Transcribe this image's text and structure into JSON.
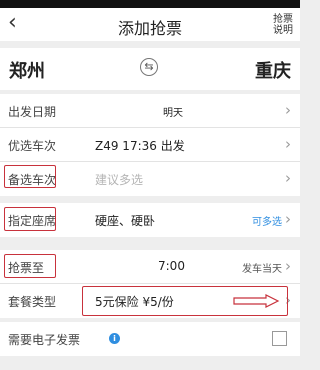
{
  "header": {
    "back_icon": "‹",
    "title": "添加抢票",
    "help_line1": "抢票",
    "help_line2": "说明"
  },
  "route": {
    "from": "郑州",
    "to": "重庆",
    "swap_icon": "⇆"
  },
  "rows": {
    "date_label": "出发日期",
    "date_value": "明天",
    "preferred_label": "优选车次",
    "preferred_value": "Z49  17:36 出发",
    "backup_label": "备选车次",
    "backup_placeholder": "建议多选",
    "seat_label": "指定座席",
    "seat_value": "硬座、硬卧",
    "seat_hint": "可多选",
    "until_label": "抢票至",
    "until_value": "7:00",
    "until_hint": "发车当天",
    "package_label": "套餐类型",
    "package_value": "5元保险 ¥5/份",
    "invoice_label": "需要电子发票",
    "info_icon": "i"
  },
  "chevron": "›",
  "colors": {
    "highlight_red": "#c8323c",
    "accent_blue": "#2f8ee0"
  }
}
